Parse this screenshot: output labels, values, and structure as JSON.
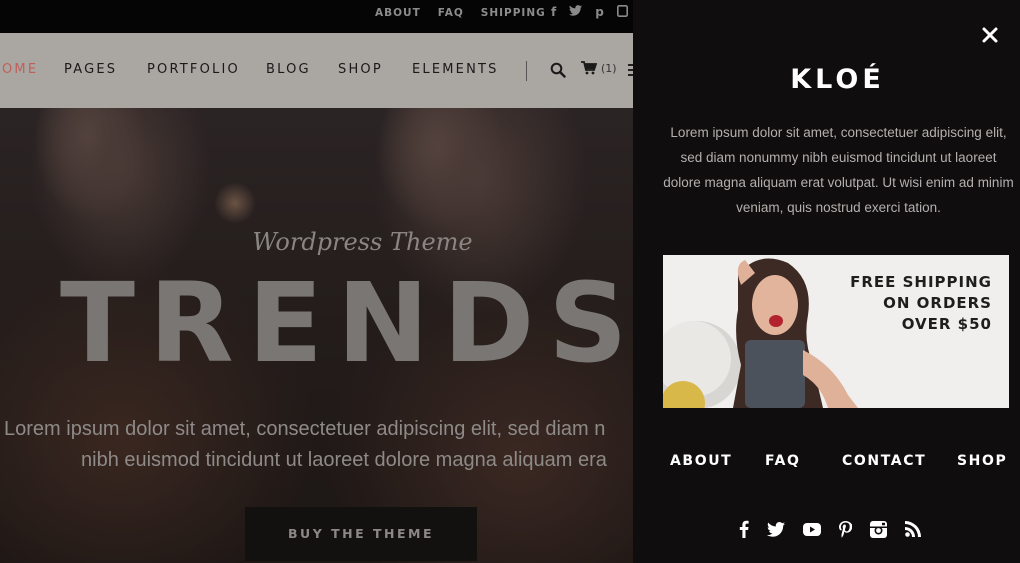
{
  "topbar": {
    "links": [
      "ABOUT",
      "FAQ",
      "SHIPPING"
    ],
    "social_icons": [
      "facebook-icon",
      "twitter-icon",
      "pinterest-icon",
      "instagram-icon"
    ]
  },
  "nav": {
    "items": [
      "HOME",
      "PAGES",
      "PORTFOLIO",
      "BLOG",
      "SHOP",
      "ELEMENTS"
    ],
    "active": "HOME",
    "cart_count": "(1)",
    "active_color": "#c0605a"
  },
  "hero": {
    "eyebrow": "Wordpress Theme",
    "title": "TRENDS",
    "desc_line1": "Lorem ipsum dolor sit amet, consectetuer adipiscing elit, sed diam n",
    "desc_line2": "nibh euismod tincidunt ut laoreet dolore magna aliquam era",
    "cta": "BUY THE THEME"
  },
  "panel": {
    "logo": "KLOÉ",
    "about": "Lorem ipsum dolor sit amet, consectetuer adipiscing elit, sed diam nonummy nibh euismod tincidunt ut laoreet dolore magna aliquam erat volutpat. Ut wisi enim ad minim veniam, quis nostrud exerci tation.",
    "banner": {
      "line1": "FREE SHIPPING",
      "line2": "ON ORDERS",
      "line3": "OVER $50"
    },
    "menu": [
      "ABOUT",
      "FAQ",
      "CONTACT",
      "SHOP"
    ],
    "social_icons": [
      "facebook-icon",
      "twitter-icon",
      "youtube-icon",
      "pinterest-icon",
      "instagram-icon",
      "rss-icon"
    ]
  }
}
